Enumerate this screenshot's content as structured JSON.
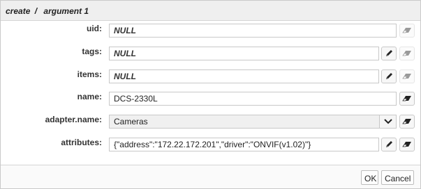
{
  "title": {
    "part1": "create",
    "separator": "/",
    "part2": "argument 1"
  },
  "fields": [
    {
      "label": "uid:",
      "value": "NULL",
      "null": true
    },
    {
      "label": "tags:",
      "value": "NULL",
      "null": true
    },
    {
      "label": "items:",
      "value": "NULL",
      "null": true
    },
    {
      "label": "name:",
      "value": "DCS-2330L",
      "null": false
    },
    {
      "label": "adapter.name:",
      "value": "Cameras",
      "null": false
    },
    {
      "label": "attributes:",
      "value": "{\"address\":\"172.22.172.201\",\"driver\":\"ONVIF(v1.02)\"}",
      "null": false
    }
  ],
  "buttons": {
    "ok": "OK",
    "cancel": "Cancel"
  },
  "icons": {
    "edit": "pencil-icon",
    "erase": "eraser-icon",
    "dropdown": "chevron-down-icon"
  }
}
